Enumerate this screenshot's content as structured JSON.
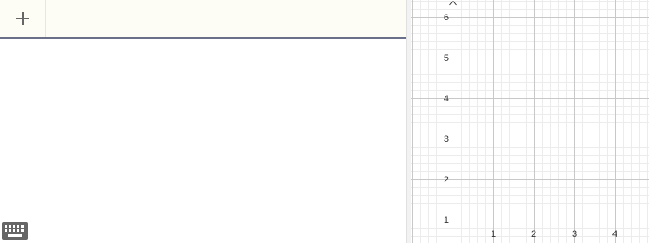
{
  "algebra": {
    "add_icon": "plus-icon",
    "input_value": "",
    "input_placeholder": ""
  },
  "graphics": {
    "x_ticks": [
      "1",
      "2",
      "3",
      "4"
    ],
    "y_ticks": [
      "1",
      "2",
      "3",
      "4",
      "5",
      "6"
    ],
    "grid_major_color": "#c8c8c8",
    "grid_minor_color": "#ececec",
    "axis_color": "#333333"
  },
  "toolbar": {
    "keyboard_icon": "keyboard-icon"
  }
}
